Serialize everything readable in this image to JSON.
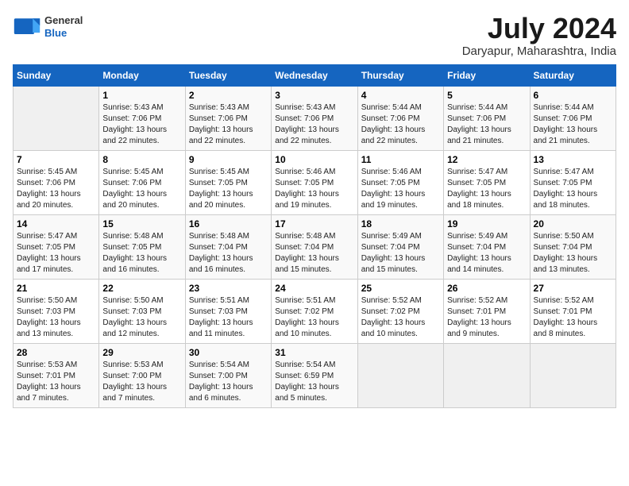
{
  "header": {
    "logo": {
      "line1": "General",
      "line2": "Blue"
    },
    "title": "July 2024",
    "location": "Daryapur, Maharashtra, India"
  },
  "columns": [
    "Sunday",
    "Monday",
    "Tuesday",
    "Wednesday",
    "Thursday",
    "Friday",
    "Saturday"
  ],
  "weeks": [
    [
      {
        "day": "",
        "info": ""
      },
      {
        "day": "1",
        "info": "Sunrise: 5:43 AM\nSunset: 7:06 PM\nDaylight: 13 hours\nand 22 minutes."
      },
      {
        "day": "2",
        "info": "Sunrise: 5:43 AM\nSunset: 7:06 PM\nDaylight: 13 hours\nand 22 minutes."
      },
      {
        "day": "3",
        "info": "Sunrise: 5:43 AM\nSunset: 7:06 PM\nDaylight: 13 hours\nand 22 minutes."
      },
      {
        "day": "4",
        "info": "Sunrise: 5:44 AM\nSunset: 7:06 PM\nDaylight: 13 hours\nand 22 minutes."
      },
      {
        "day": "5",
        "info": "Sunrise: 5:44 AM\nSunset: 7:06 PM\nDaylight: 13 hours\nand 21 minutes."
      },
      {
        "day": "6",
        "info": "Sunrise: 5:44 AM\nSunset: 7:06 PM\nDaylight: 13 hours\nand 21 minutes."
      }
    ],
    [
      {
        "day": "7",
        "info": "Sunrise: 5:45 AM\nSunset: 7:06 PM\nDaylight: 13 hours\nand 20 minutes."
      },
      {
        "day": "8",
        "info": "Sunrise: 5:45 AM\nSunset: 7:06 PM\nDaylight: 13 hours\nand 20 minutes."
      },
      {
        "day": "9",
        "info": "Sunrise: 5:45 AM\nSunset: 7:05 PM\nDaylight: 13 hours\nand 20 minutes."
      },
      {
        "day": "10",
        "info": "Sunrise: 5:46 AM\nSunset: 7:05 PM\nDaylight: 13 hours\nand 19 minutes."
      },
      {
        "day": "11",
        "info": "Sunrise: 5:46 AM\nSunset: 7:05 PM\nDaylight: 13 hours\nand 19 minutes."
      },
      {
        "day": "12",
        "info": "Sunrise: 5:47 AM\nSunset: 7:05 PM\nDaylight: 13 hours\nand 18 minutes."
      },
      {
        "day": "13",
        "info": "Sunrise: 5:47 AM\nSunset: 7:05 PM\nDaylight: 13 hours\nand 18 minutes."
      }
    ],
    [
      {
        "day": "14",
        "info": "Sunrise: 5:47 AM\nSunset: 7:05 PM\nDaylight: 13 hours\nand 17 minutes."
      },
      {
        "day": "15",
        "info": "Sunrise: 5:48 AM\nSunset: 7:05 PM\nDaylight: 13 hours\nand 16 minutes."
      },
      {
        "day": "16",
        "info": "Sunrise: 5:48 AM\nSunset: 7:04 PM\nDaylight: 13 hours\nand 16 minutes."
      },
      {
        "day": "17",
        "info": "Sunrise: 5:48 AM\nSunset: 7:04 PM\nDaylight: 13 hours\nand 15 minutes."
      },
      {
        "day": "18",
        "info": "Sunrise: 5:49 AM\nSunset: 7:04 PM\nDaylight: 13 hours\nand 15 minutes."
      },
      {
        "day": "19",
        "info": "Sunrise: 5:49 AM\nSunset: 7:04 PM\nDaylight: 13 hours\nand 14 minutes."
      },
      {
        "day": "20",
        "info": "Sunrise: 5:50 AM\nSunset: 7:04 PM\nDaylight: 13 hours\nand 13 minutes."
      }
    ],
    [
      {
        "day": "21",
        "info": "Sunrise: 5:50 AM\nSunset: 7:03 PM\nDaylight: 13 hours\nand 13 minutes."
      },
      {
        "day": "22",
        "info": "Sunrise: 5:50 AM\nSunset: 7:03 PM\nDaylight: 13 hours\nand 12 minutes."
      },
      {
        "day": "23",
        "info": "Sunrise: 5:51 AM\nSunset: 7:03 PM\nDaylight: 13 hours\nand 11 minutes."
      },
      {
        "day": "24",
        "info": "Sunrise: 5:51 AM\nSunset: 7:02 PM\nDaylight: 13 hours\nand 10 minutes."
      },
      {
        "day": "25",
        "info": "Sunrise: 5:52 AM\nSunset: 7:02 PM\nDaylight: 13 hours\nand 10 minutes."
      },
      {
        "day": "26",
        "info": "Sunrise: 5:52 AM\nSunset: 7:01 PM\nDaylight: 13 hours\nand 9 minutes."
      },
      {
        "day": "27",
        "info": "Sunrise: 5:52 AM\nSunset: 7:01 PM\nDaylight: 13 hours\nand 8 minutes."
      }
    ],
    [
      {
        "day": "28",
        "info": "Sunrise: 5:53 AM\nSunset: 7:01 PM\nDaylight: 13 hours\nand 7 minutes."
      },
      {
        "day": "29",
        "info": "Sunrise: 5:53 AM\nSunset: 7:00 PM\nDaylight: 13 hours\nand 7 minutes."
      },
      {
        "day": "30",
        "info": "Sunrise: 5:54 AM\nSunset: 7:00 PM\nDaylight: 13 hours\nand 6 minutes."
      },
      {
        "day": "31",
        "info": "Sunrise: 5:54 AM\nSunset: 6:59 PM\nDaylight: 13 hours\nand 5 minutes."
      },
      {
        "day": "",
        "info": ""
      },
      {
        "day": "",
        "info": ""
      },
      {
        "day": "",
        "info": ""
      }
    ]
  ]
}
